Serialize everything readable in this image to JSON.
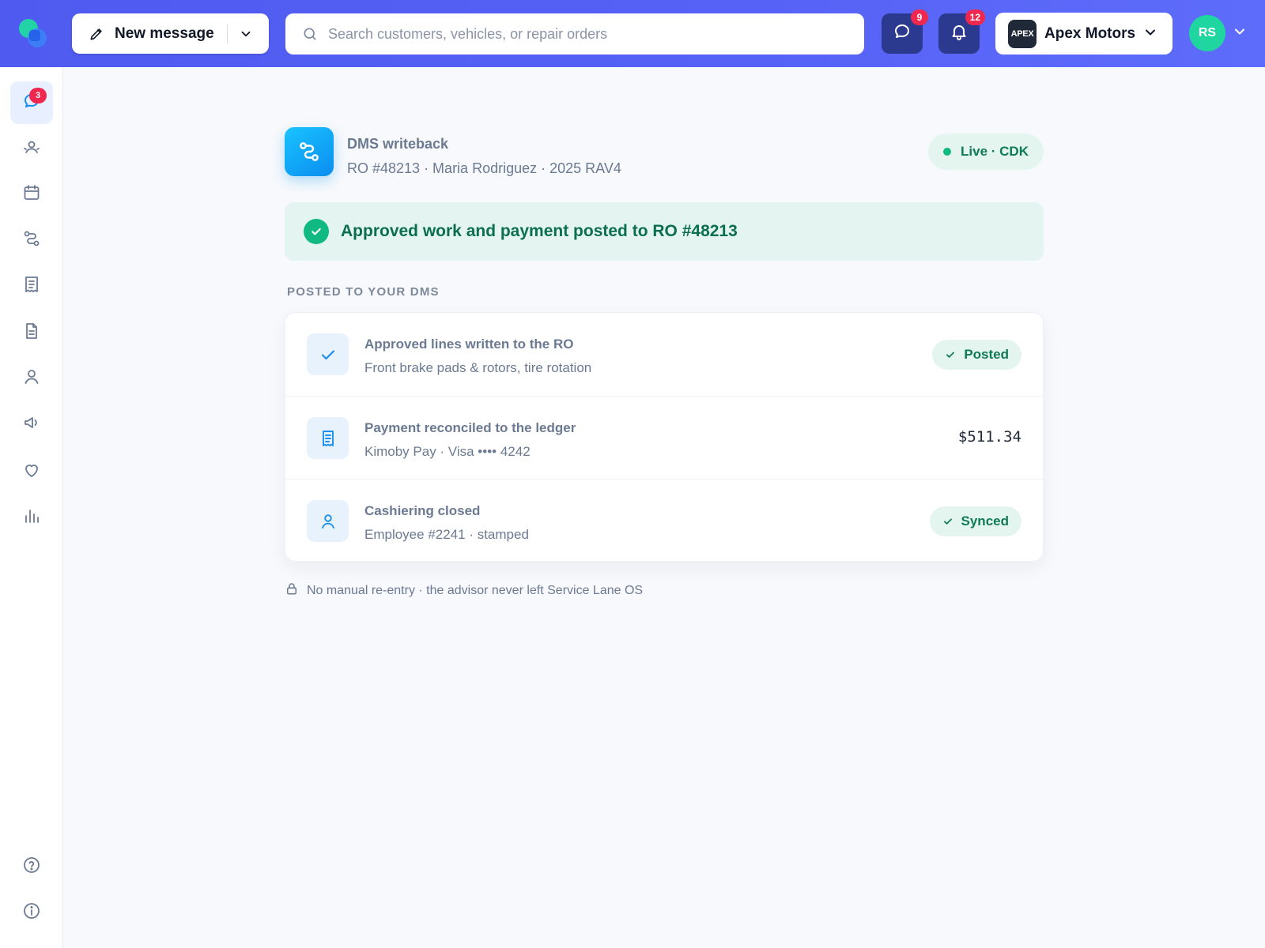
{
  "topbar": {
    "new_message_label": "New message",
    "search_placeholder": "Search customers, vehicles, or repair orders",
    "messages_badge": "9",
    "notifications_badge": "12",
    "store_logo_text": "APEX",
    "store_name": "Apex Motors",
    "avatar_initials": "RS"
  },
  "sidebar": {
    "items": [
      {
        "icon": "chat-icon",
        "active": true,
        "badge": "3"
      },
      {
        "icon": "customers-icon"
      },
      {
        "icon": "calendar-icon"
      },
      {
        "icon": "route-icon"
      },
      {
        "icon": "receipt-icon"
      },
      {
        "icon": "document-icon"
      },
      {
        "icon": "user-icon"
      },
      {
        "icon": "megaphone-icon"
      },
      {
        "icon": "heart-icon"
      },
      {
        "icon": "analytics-icon"
      }
    ],
    "bottom": [
      {
        "icon": "help-icon"
      },
      {
        "icon": "info-icon"
      }
    ]
  },
  "main": {
    "header_title": "DMS writeback",
    "header_subtitle": "RO #48213 · Maria Rodriguez · 2025 RAV4",
    "status_pill": "Live · CDK",
    "banner_text": "Approved work and payment posted to RO #48213",
    "section_label": "POSTED TO YOUR DMS",
    "rows": [
      {
        "title": "Approved lines written to the RO",
        "subtitle": "Front brake pads & rotors, tire rotation",
        "status": "Posted",
        "icon": "check-icon"
      },
      {
        "title": "Payment reconciled to the ledger",
        "subtitle": "Kimoby Pay · Visa •••• 4242",
        "amount": "$511.34",
        "icon": "receipt-icon"
      },
      {
        "title": "Cashiering closed",
        "subtitle": "Employee #2241 · stamped",
        "status": "Synced",
        "icon": "user-icon"
      }
    ],
    "footnote": "No manual re-entry · the advisor never left Service Lane OS"
  },
  "colors": {
    "topbar": "#5662f5",
    "accent_green": "#10b981",
    "badge_red": "#f0284f",
    "icon_blue": "#1b8ff0"
  }
}
